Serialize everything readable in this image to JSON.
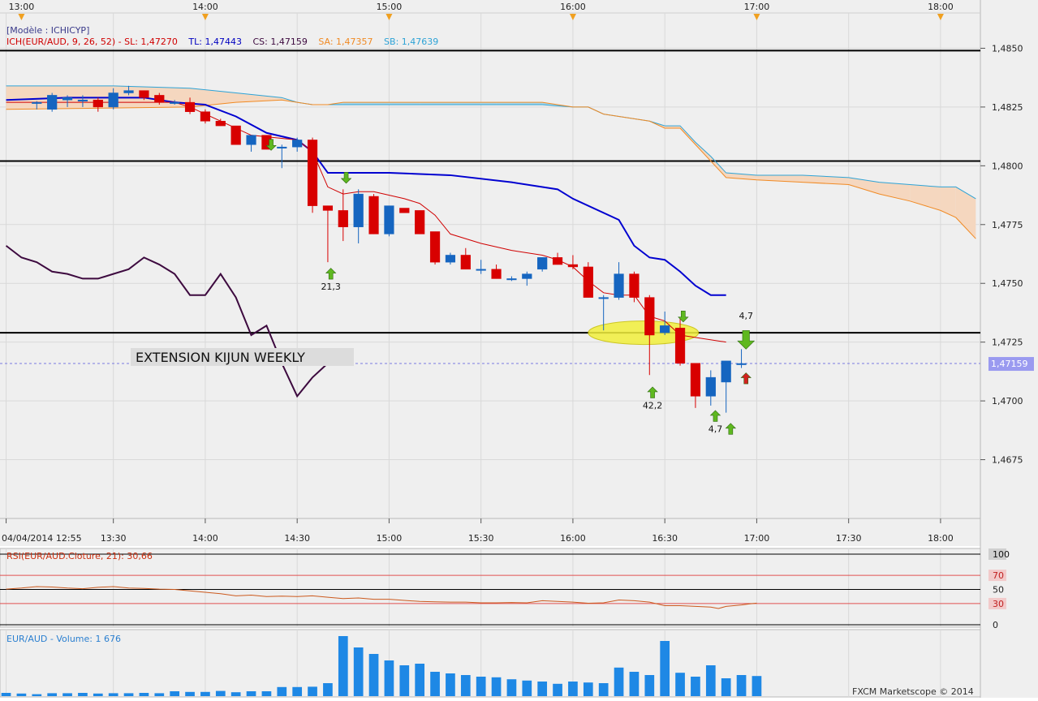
{
  "header": {
    "model_label": "[Modèle : ICHICYP]",
    "ich_label": "ICH(EUR/AUD, 9, 26, 52) -  SL: 1,47270",
    "tl_label": "TL: 1,47443",
    "cs_label": "CS: 1,47159",
    "sa_label": "SA: 1,47357",
    "sb_label": "SB: 1,47639"
  },
  "colors": {
    "background": "#efefef",
    "grid": "#d9d9d9",
    "bull_candle": "#1565c0",
    "bear_candle": "#d80000",
    "tenkan": "#d00000",
    "kijun": "#0000d0",
    "chikou": "#3d0a3f",
    "span_a": "#f08a24",
    "span_b": "#2ea3d6",
    "cloud_bear": "#f5d7bf",
    "cloud_bull": "#a9d7ea",
    "volume": "#1e88e5",
    "rsi": "#cc5a1e",
    "arrow_green": "#5fb820",
    "arrow_red": "#d32020",
    "highlight": "#f2f03c",
    "price_tag": "#9a9af0"
  },
  "chart_data": {
    "type": "candlestick",
    "instrument": "EUR/AUD",
    "timeframe_minutes": 5,
    "ylim": [
      1.465,
      1.4865
    ],
    "y_ticks": [
      "1,4850",
      "1,4825",
      "1,4800",
      "1,4775",
      "1,4750",
      "1,4725",
      "1,4700",
      "1,4675"
    ],
    "y_tick_values": [
      1.485,
      1.4825,
      1.48,
      1.4775,
      1.475,
      1.4725,
      1.47,
      1.4675
    ],
    "top_time_ticks": [
      "13:00",
      "14:00",
      "15:00",
      "16:00",
      "17:00",
      "18:00"
    ],
    "top_time_values": [
      -1,
      11,
      23,
      35,
      47,
      59
    ],
    "bottom_time_ticks": [
      "04/04/2014 12:55",
      "13:30",
      "14:00",
      "14:30",
      "15:00",
      "15:30",
      "16:00",
      "16:30",
      "17:00",
      "17:30",
      "18:00"
    ],
    "bottom_time_values": [
      -2,
      5,
      11,
      17,
      23,
      29,
      35,
      41,
      47,
      53,
      59
    ],
    "x_range": [
      -2.4,
      61.6
    ],
    "candles": [
      [
        1.48265,
        1.48275,
        1.4824,
        1.4827
      ],
      [
        1.4824,
        1.4831,
        1.4823,
        1.483
      ],
      [
        1.4828,
        1.483,
        1.4825,
        1.4829
      ],
      [
        1.4828,
        1.483,
        1.4825,
        1.4828
      ],
      [
        1.4828,
        1.4829,
        1.4823,
        1.4825
      ],
      [
        1.4825,
        1.4833,
        1.4824,
        1.4831
      ],
      [
        1.4831,
        1.4834,
        1.483,
        1.4832
      ],
      [
        1.4832,
        1.4832,
        1.4828,
        1.4829
      ],
      [
        1.483,
        1.4831,
        1.4826,
        1.4827
      ],
      [
        1.4827,
        1.4828,
        1.4826,
        1.4827
      ],
      [
        1.4827,
        1.4829,
        1.4822,
        1.4823
      ],
      [
        1.4823,
        1.4824,
        1.4818,
        1.4819
      ],
      [
        1.4819,
        1.482,
        1.4817,
        1.4817
      ],
      [
        1.4817,
        1.4817,
        1.4809,
        1.4809
      ],
      [
        1.4809,
        1.4813,
        1.4806,
        1.4813
      ],
      [
        1.4813,
        1.4813,
        1.4807,
        1.4807
      ],
      [
        1.4808,
        1.4809,
        1.4799,
        1.4808
      ],
      [
        1.4808,
        1.4812,
        1.4806,
        1.4811
      ],
      [
        1.4811,
        1.4812,
        1.478,
        1.4783
      ],
      [
        1.4783,
        1.4783,
        1.4759,
        1.4781
      ],
      [
        1.4781,
        1.479,
        1.4768,
        1.4774
      ],
      [
        1.4774,
        1.479,
        1.4767,
        1.4788
      ],
      [
        1.4787,
        1.4788,
        1.4771,
        1.4771
      ],
      [
        1.4771,
        1.4783,
        1.477,
        1.4783
      ],
      [
        1.4782,
        1.4782,
        1.478,
        1.478
      ],
      [
        1.4781,
        1.4781,
        1.4771,
        1.4771
      ],
      [
        1.4772,
        1.4772,
        1.4758,
        1.4759
      ],
      [
        1.4759,
        1.4763,
        1.4758,
        1.4762
      ],
      [
        1.4762,
        1.4765,
        1.4756,
        1.4756
      ],
      [
        1.4756,
        1.476,
        1.4754,
        1.4756
      ],
      [
        1.4756,
        1.4758,
        1.4752,
        1.4752
      ],
      [
        1.4752,
        1.4753,
        1.4751,
        1.4752
      ],
      [
        1.4752,
        1.4755,
        1.4749,
        1.4754
      ],
      [
        1.4756,
        1.4761,
        1.4755,
        1.4761
      ],
      [
        1.4761,
        1.4763,
        1.4758,
        1.4758
      ],
      [
        1.4758,
        1.4762,
        1.4756,
        1.4757
      ],
      [
        1.4757,
        1.4759,
        1.4744,
        1.4744
      ],
      [
        1.4744,
        1.4745,
        1.473,
        1.4744
      ],
      [
        1.4744,
        1.4759,
        1.4743,
        1.4754
      ],
      [
        1.4754,
        1.4755,
        1.4742,
        1.4744
      ],
      [
        1.4744,
        1.4745,
        1.4711,
        1.4728
      ],
      [
        1.4729,
        1.4738,
        1.4728,
        1.4732
      ],
      [
        1.4731,
        1.4735,
        1.4715,
        1.4716
      ],
      [
        1.4716,
        1.4716,
        1.4697,
        1.4702
      ],
      [
        1.4702,
        1.4713,
        1.4698,
        1.471
      ],
      [
        1.4708,
        1.4717,
        1.4695,
        1.4717
      ],
      [
        1.47155,
        1.4722,
        1.4714,
        1.47159
      ]
    ],
    "kijun": [
      [
        -2,
        1.4828
      ],
      [
        2,
        1.4829
      ],
      [
        7,
        1.4829
      ],
      [
        9,
        1.4827
      ],
      [
        11,
        1.4826
      ],
      [
        13,
        1.4821
      ],
      [
        15,
        1.4814
      ],
      [
        17,
        1.4811
      ],
      [
        18,
        1.4806
      ],
      [
        19,
        1.4797
      ],
      [
        23,
        1.4797
      ],
      [
        27,
        1.4796
      ],
      [
        31,
        1.4793
      ],
      [
        34,
        1.479
      ],
      [
        35,
        1.4786
      ],
      [
        38,
        1.4777
      ],
      [
        39,
        1.4766
      ],
      [
        40,
        1.4761
      ],
      [
        41,
        1.476
      ],
      [
        42,
        1.4755
      ],
      [
        43,
        1.4749
      ],
      [
        44,
        1.4745
      ],
      [
        45,
        1.4745
      ]
    ],
    "tenkan": [
      [
        -2,
        1.4827
      ],
      [
        9,
        1.4827
      ],
      [
        10,
        1.4825
      ],
      [
        11,
        1.4822
      ],
      [
        14,
        1.4813
      ],
      [
        17,
        1.4811
      ],
      [
        18,
        1.4806
      ],
      [
        19,
        1.4791
      ],
      [
        20,
        1.4788
      ],
      [
        21,
        1.4789
      ],
      [
        22,
        1.4789
      ],
      [
        24,
        1.4786
      ],
      [
        25,
        1.4784
      ],
      [
        26,
        1.4779
      ],
      [
        27,
        1.4771
      ],
      [
        29,
        1.4767
      ],
      [
        31,
        1.4764
      ],
      [
        33,
        1.4762
      ],
      [
        34,
        1.476
      ],
      [
        35,
        1.4757
      ],
      [
        36,
        1.4751
      ],
      [
        37,
        1.4746
      ],
      [
        38,
        1.4745
      ],
      [
        39,
        1.4745
      ],
      [
        40,
        1.4736
      ],
      [
        41,
        1.4734
      ],
      [
        42,
        1.4728
      ],
      [
        45,
        1.4725
      ]
    ],
    "chikou": [
      [
        -2,
        1.4766
      ],
      [
        -1,
        1.4761
      ],
      [
        0,
        1.4759
      ],
      [
        1,
        1.4755
      ],
      [
        2,
        1.4754
      ],
      [
        3,
        1.4752
      ],
      [
        4,
        1.4752
      ],
      [
        5,
        1.4754
      ],
      [
        6,
        1.4756
      ],
      [
        7,
        1.4761
      ],
      [
        8,
        1.4758
      ],
      [
        9,
        1.4754
      ],
      [
        10,
        1.4745
      ],
      [
        11,
        1.4745
      ],
      [
        12,
        1.4754
      ],
      [
        13,
        1.4744
      ],
      [
        14,
        1.4728
      ],
      [
        15,
        1.4732
      ],
      [
        16,
        1.4716
      ],
      [
        17,
        1.4702
      ],
      [
        18,
        1.471
      ],
      [
        19,
        1.4716
      ],
      [
        20,
        1.4716
      ]
    ],
    "span_a": [
      [
        -2,
        1.4824
      ],
      [
        10,
        1.4825
      ],
      [
        13,
        1.4827
      ],
      [
        16,
        1.4828
      ],
      [
        17,
        1.4827
      ],
      [
        18,
        1.4826
      ],
      [
        19,
        1.4826
      ],
      [
        20,
        1.4827
      ],
      [
        25,
        1.4827
      ],
      [
        30,
        1.4827
      ],
      [
        33,
        1.4827
      ],
      [
        35,
        1.4825
      ],
      [
        36,
        1.4825
      ],
      [
        37,
        1.4822
      ],
      [
        38,
        1.4821
      ],
      [
        39,
        1.482
      ],
      [
        40,
        1.4819
      ],
      [
        41,
        1.4816
      ],
      [
        42,
        1.4816
      ],
      [
        43,
        1.4809
      ],
      [
        44,
        1.4802
      ],
      [
        45,
        1.4795
      ],
      [
        47,
        1.4794
      ],
      [
        50,
        1.4793
      ],
      [
        53,
        1.4792
      ],
      [
        55,
        1.4788
      ],
      [
        57,
        1.4785
      ],
      [
        59,
        1.4781
      ],
      [
        60,
        1.4778
      ],
      [
        61.3,
        1.4769
      ]
    ],
    "span_b": [
      [
        -2,
        1.4834
      ],
      [
        5,
        1.4834
      ],
      [
        10,
        1.4833
      ],
      [
        13,
        1.4831
      ],
      [
        16,
        1.4829
      ],
      [
        17,
        1.4827
      ],
      [
        18,
        1.4826
      ],
      [
        20,
        1.4826
      ],
      [
        25,
        1.4826
      ],
      [
        30,
        1.4826
      ],
      [
        33,
        1.4826
      ],
      [
        35,
        1.4825
      ],
      [
        36,
        1.4825
      ],
      [
        37,
        1.4822
      ],
      [
        38,
        1.4821
      ],
      [
        39,
        1.482
      ],
      [
        40,
        1.4819
      ],
      [
        41,
        1.4817
      ],
      [
        42,
        1.4817
      ],
      [
        43,
        1.481
      ],
      [
        44,
        1.4804
      ],
      [
        45,
        1.4797
      ],
      [
        47,
        1.4796
      ],
      [
        50,
        1.4796
      ],
      [
        53,
        1.4795
      ],
      [
        55,
        1.4793
      ],
      [
        57,
        1.4792
      ],
      [
        59,
        1.4791
      ],
      [
        60,
        1.4791
      ],
      [
        61.3,
        1.4786
      ]
    ],
    "horizontal_lines": [
      1.4849,
      1.4802,
      1.4729
    ],
    "current_price": 1.47159,
    "current_price_label": "1,47159",
    "annotation_text": "EXTENSION KIJUN WEEKLY",
    "highlight_ellipse": {
      "x_center": 39.6,
      "y_center": 1.4729,
      "x_halfwidth": 3.6,
      "y_halfwidth": 0.0005
    },
    "signals": [
      {
        "idx": 15.3,
        "price": 1.48095,
        "dir": "down",
        "color": "green",
        "label": ""
      },
      {
        "idx": 19.2,
        "price": 1.47535,
        "dir": "up",
        "color": "green",
        "label": "21,3"
      },
      {
        "idx": 20.2,
        "price": 1.47955,
        "dir": "down",
        "color": "green",
        "label": ""
      },
      {
        "idx": 40.2,
        "price": 1.4703,
        "dir": "up",
        "color": "green",
        "label": "42,2"
      },
      {
        "idx": 42.2,
        "price": 1.47365,
        "dir": "down",
        "color": "green",
        "label": ""
      },
      {
        "idx": 44.3,
        "price": 1.4693,
        "dir": "up",
        "color": "green",
        "label": "4,7"
      },
      {
        "idx": 45.3,
        "price": 1.46875,
        "dir": "up",
        "color": "green",
        "label": ""
      },
      {
        "idx": 46.3,
        "price": 1.4727,
        "dir": "down",
        "color": "green",
        "label": "4,7",
        "big": true
      },
      {
        "idx": 46.3,
        "price": 1.4709,
        "dir": "up",
        "color": "red",
        "label": ""
      }
    ],
    "rsi": {
      "label": "RSI(EUR/AUD.Cloture, 21): 30,66",
      "levels": [
        100,
        70,
        50,
        30,
        0
      ],
      "level_labels": [
        "100",
        "70",
        "50",
        "30",
        "0"
      ],
      "values": [
        [
          -2,
          50.5
        ],
        [
          -1,
          52
        ],
        [
          0,
          54
        ],
        [
          1,
          53.5
        ],
        [
          2,
          52
        ],
        [
          3,
          51
        ],
        [
          4,
          53
        ],
        [
          5,
          54
        ],
        [
          6,
          52
        ],
        [
          7,
          51.5
        ],
        [
          8,
          50.5
        ],
        [
          9,
          50
        ],
        [
          10,
          48
        ],
        [
          11,
          46
        ],
        [
          12,
          44
        ],
        [
          13,
          41
        ],
        [
          14,
          42
        ],
        [
          15,
          40
        ],
        [
          16,
          40.5
        ],
        [
          17,
          40
        ],
        [
          18,
          41
        ],
        [
          19,
          39
        ],
        [
          20,
          37
        ],
        [
          21,
          38
        ],
        [
          22,
          36
        ],
        [
          23,
          36
        ],
        [
          24,
          34.5
        ],
        [
          25,
          33
        ],
        [
          26,
          32.5
        ],
        [
          27,
          32
        ],
        [
          28,
          32
        ],
        [
          29,
          31
        ],
        [
          30,
          31
        ],
        [
          31,
          31.5
        ],
        [
          32,
          31
        ],
        [
          33,
          34
        ],
        [
          34,
          33
        ],
        [
          35,
          32
        ],
        [
          36,
          30.5
        ],
        [
          37,
          31
        ],
        [
          38,
          35
        ],
        [
          39,
          34
        ],
        [
          40,
          32
        ],
        [
          41,
          27
        ],
        [
          42,
          27
        ],
        [
          43,
          26
        ],
        [
          44,
          25
        ],
        [
          44.5,
          23
        ],
        [
          45,
          26
        ],
        [
          46,
          28
        ],
        [
          46.5,
          29.5
        ],
        [
          47,
          30.66
        ]
      ]
    },
    "volume": {
      "label": "EUR/AUD - Volume: 1 676",
      "max": 200,
      "values": [
        10,
        8,
        6,
        9,
        9,
        10,
        8,
        9,
        9,
        10,
        9,
        15,
        13,
        13,
        16,
        12,
        15,
        15,
        28,
        28,
        29,
        40,
        185,
        150,
        130,
        110,
        95,
        100,
        75,
        70,
        65,
        60,
        58,
        52,
        48,
        45,
        38,
        45,
        42,
        40,
        88,
        75,
        65,
        170,
        72,
        60,
        95,
        55,
        65,
        62
      ]
    }
  },
  "footer": {
    "copyright": "FXCM Marketscope © 2014"
  }
}
